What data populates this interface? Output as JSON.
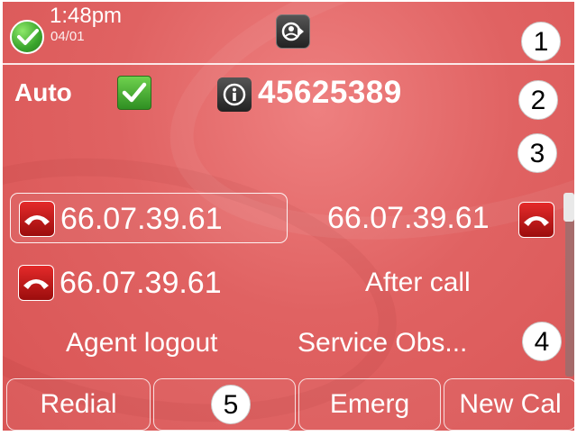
{
  "status_bar": {
    "time": "1:48pm",
    "date": "04/01",
    "status_icon": "green-check-icon",
    "redirect_icon": "call-redirect-icon"
  },
  "agent": {
    "mode_label": "Auto",
    "mode_checked": true,
    "info_icon": "info-icon",
    "agent_number": "45625389"
  },
  "line_keys": [
    {
      "label": "66.07.39.61",
      "icon": "hangup-icon"
    },
    {
      "label": "66.07.39.61",
      "icon": "hangup-icon"
    },
    {
      "label": "66.07.39.61",
      "icon": "hangup-icon"
    },
    {
      "label": "After call"
    },
    {
      "label": "Agent logout"
    },
    {
      "label": "Service Obs..."
    }
  ],
  "softkeys": [
    {
      "label": "Redial"
    },
    {
      "label": ""
    },
    {
      "label": "Emerg"
    },
    {
      "label": "New Cal"
    }
  ],
  "callouts": [
    "1",
    "2",
    "3",
    "4",
    "5"
  ],
  "colors": {
    "background": "#e06262",
    "status_green": "#3aa52c",
    "hangup_red": "#c41414"
  }
}
